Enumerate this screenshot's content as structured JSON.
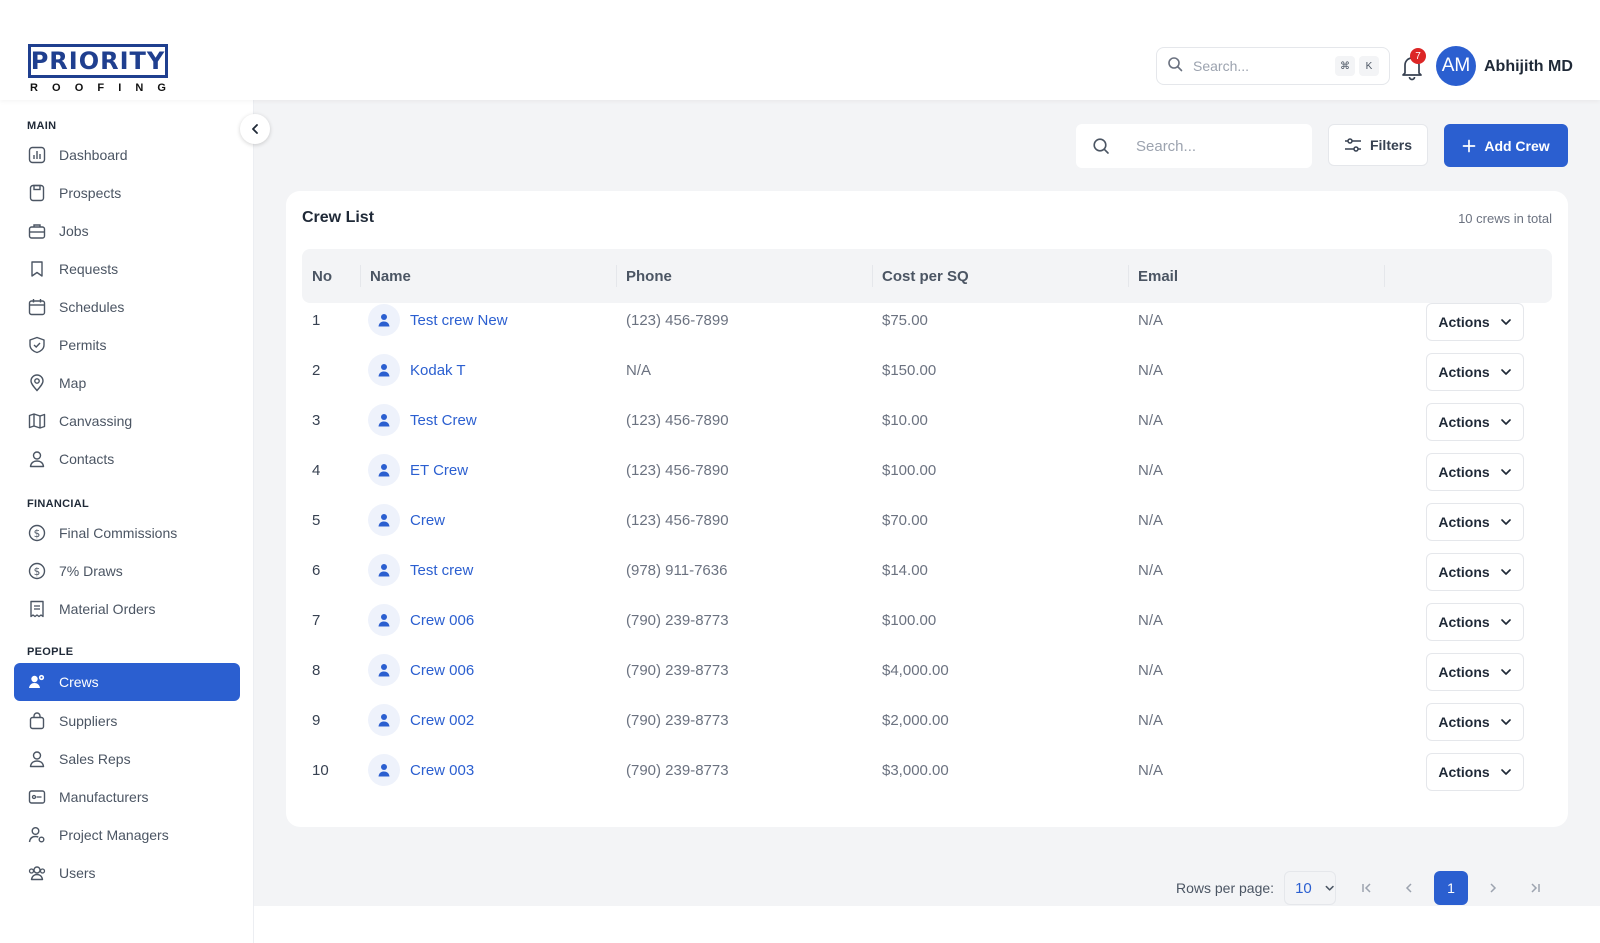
{
  "brand": {
    "name": "PRIORITY",
    "subtitle": [
      "R",
      "O",
      "O",
      "F",
      "I",
      "N",
      "G"
    ],
    "color": "#1f3f8f"
  },
  "header": {
    "search_placeholder": "Search...",
    "shortcut_keys": [
      "⌘",
      "K"
    ],
    "notification_count": "7",
    "user_initials": "AM",
    "user_name": "Abhijith MD"
  },
  "sidebar": {
    "sections": [
      {
        "title": "MAIN",
        "items": [
          {
            "label": "Dashboard",
            "icon": "dashboard-icon"
          },
          {
            "label": "Prospects",
            "icon": "prospects-icon"
          },
          {
            "label": "Jobs",
            "icon": "briefcase-icon"
          },
          {
            "label": "Requests",
            "icon": "bookmark-icon"
          },
          {
            "label": "Schedules",
            "icon": "calendar-icon"
          },
          {
            "label": "Permits",
            "icon": "shield-icon"
          },
          {
            "label": "Map",
            "icon": "map-pin-icon"
          },
          {
            "label": "Canvassing",
            "icon": "map-icon"
          },
          {
            "label": "Contacts",
            "icon": "user-icon"
          }
        ]
      },
      {
        "title": "FINANCIAL",
        "items": [
          {
            "label": "Final Commissions",
            "icon": "dollar-icon"
          },
          {
            "label": "7% Draws",
            "icon": "dollar-icon"
          },
          {
            "label": "Material Orders",
            "icon": "receipt-icon"
          }
        ]
      },
      {
        "title": "PEOPLE",
        "items": [
          {
            "label": "Crews",
            "icon": "crews-icon",
            "active": true
          },
          {
            "label": "Suppliers",
            "icon": "bag-icon"
          },
          {
            "label": "Sales Reps",
            "icon": "user-icon"
          },
          {
            "label": "Manufacturers",
            "icon": "factory-icon"
          },
          {
            "label": "Project Managers",
            "icon": "user-gear-icon"
          },
          {
            "label": "Users",
            "icon": "users-icon"
          }
        ]
      }
    ]
  },
  "toolbar": {
    "search_placeholder": "Search...",
    "filters_label": "Filters",
    "add_label": "Add Crew"
  },
  "crew_list": {
    "title": "Crew List",
    "total_label": "10 crews in total",
    "columns": [
      "No",
      "Name",
      "Phone",
      "Cost per SQ",
      "Email"
    ],
    "action_label": "Actions",
    "rows": [
      {
        "no": "1",
        "name": "Test crew New",
        "phone": "(123) 456-7899",
        "cost": "$75.00",
        "email": "N/A"
      },
      {
        "no": "2",
        "name": "Kodak T",
        "phone": "N/A",
        "cost": "$150.00",
        "email": "N/A"
      },
      {
        "no": "3",
        "name": "Test Crew",
        "phone": "(123) 456-7890",
        "cost": "$10.00",
        "email": "N/A"
      },
      {
        "no": "4",
        "name": "ET Crew",
        "phone": "(123) 456-7890",
        "cost": "$100.00",
        "email": "N/A"
      },
      {
        "no": "5",
        "name": "Crew",
        "phone": "(123) 456-7890",
        "cost": "$70.00",
        "email": "N/A"
      },
      {
        "no": "6",
        "name": "Test crew",
        "phone": "(978) 911-7636",
        "cost": "$14.00",
        "email": "N/A"
      },
      {
        "no": "7",
        "name": "Crew 006",
        "phone": "(790) 239-8773",
        "cost": "$100.00",
        "email": "N/A"
      },
      {
        "no": "8",
        "name": "Crew 006",
        "phone": "(790) 239-8773",
        "cost": "$4,000.00",
        "email": "N/A"
      },
      {
        "no": "9",
        "name": "Crew 002",
        "phone": "(790) 239-8773",
        "cost": "$2,000.00",
        "email": "N/A"
      },
      {
        "no": "10",
        "name": "Crew 003",
        "phone": "(790) 239-8773",
        "cost": "$3,000.00",
        "email": "N/A"
      }
    ]
  },
  "pagination": {
    "rows_per_page_label": "Rows per page:",
    "rows_per_page": "10",
    "current_page": "1"
  },
  "colors": {
    "accent": "#2b5fd0",
    "badge": "#dc2626",
    "background": "#f3f4f6"
  }
}
